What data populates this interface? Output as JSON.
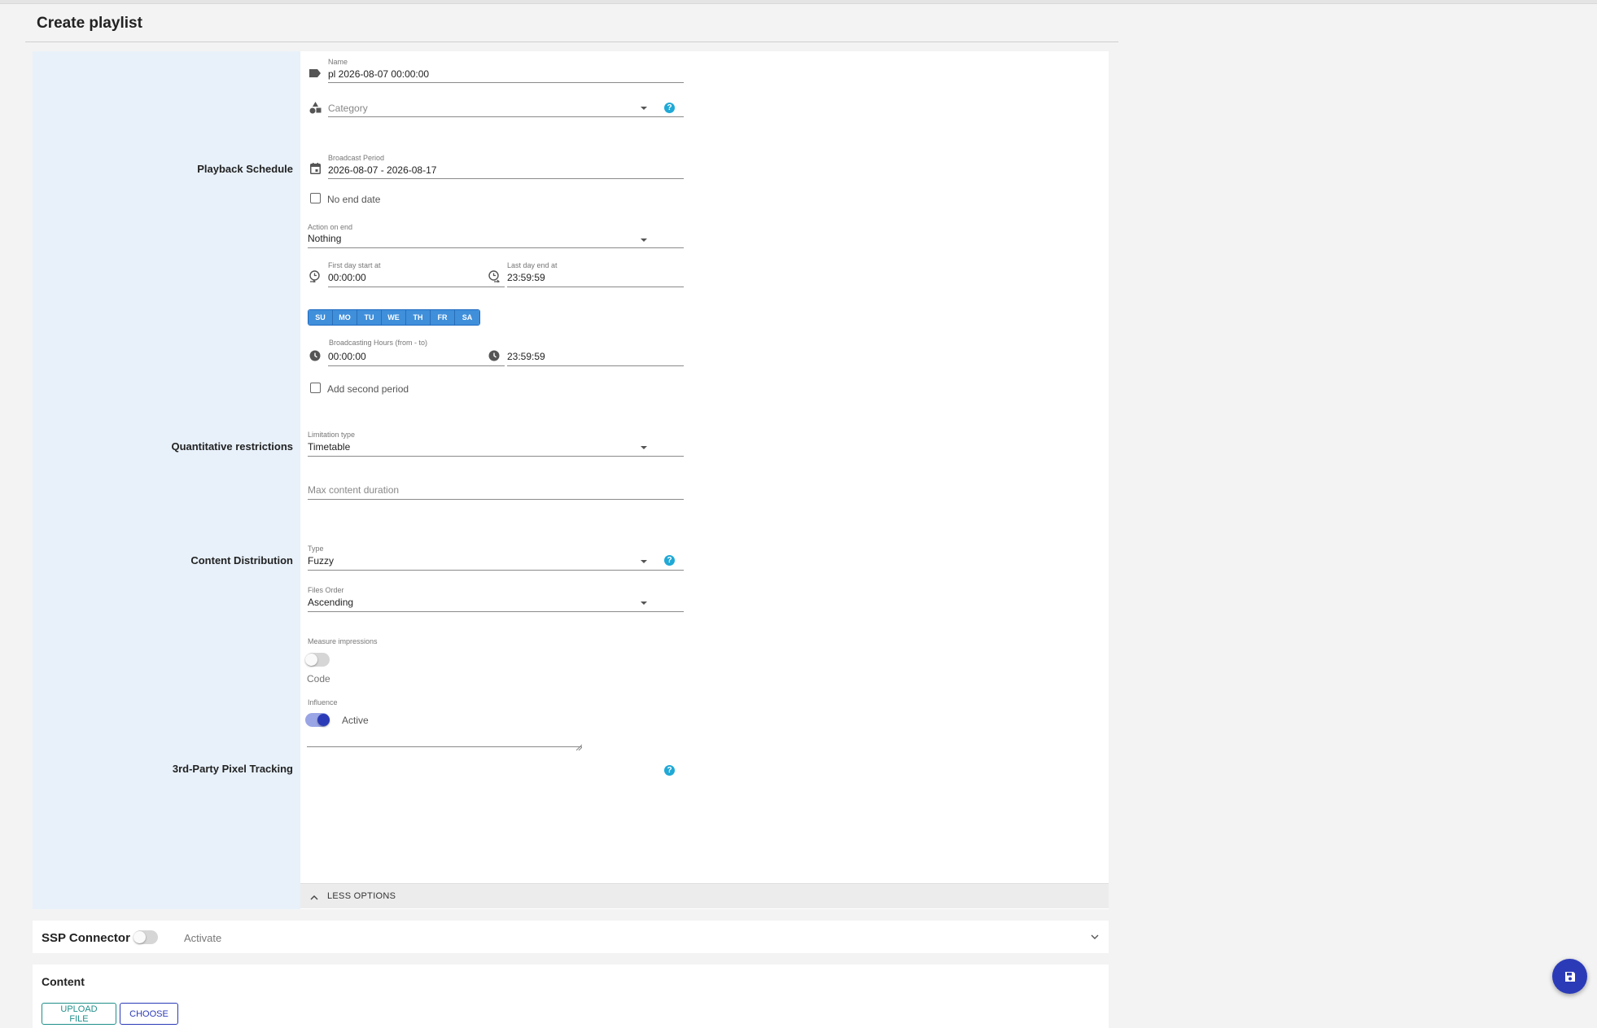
{
  "page": {
    "title": "Create playlist"
  },
  "sections": {
    "playback_schedule": "Playback Schedule",
    "quantitative_restrictions": "Quantitative restrictions",
    "content_distribution": "Content Distribution",
    "pixel_tracking": "3rd-Party Pixel Tracking"
  },
  "form": {
    "name": {
      "label": "Name",
      "value": "pl 2026-08-07 00:00:00",
      "icon": "label-icon"
    },
    "category": {
      "placeholder": "Category",
      "icon": "category-shapes-icon"
    },
    "broadcast_period": {
      "label": "Broadcast Period",
      "value": "2026-08-07 - 2026-08-17",
      "icon": "calendar-icon"
    },
    "no_end_date": {
      "label": "No end date",
      "checked": false
    },
    "action_on_end": {
      "label": "Action on end",
      "value": "Nothing"
    },
    "first_day_start": {
      "label": "First day start at",
      "value": "00:00:00",
      "icon": "alarm-start-icon"
    },
    "last_day_end": {
      "label": "Last day end at",
      "value": "23:59:59",
      "icon": "alarm-end-icon"
    },
    "days": [
      "SU",
      "MO",
      "TU",
      "WE",
      "TH",
      "FR",
      "SA"
    ],
    "broadcasting_hours": {
      "label": "Broadcasting Hours (from - to)",
      "from": "00:00:00",
      "to": "23:59:59",
      "icon": "clock-icon"
    },
    "add_second_period": {
      "label": "Add second period",
      "checked": false
    },
    "limitation_type": {
      "label": "Limitation type",
      "value": "Timetable"
    },
    "max_content_duration": {
      "placeholder": "Max content duration"
    },
    "distribution_type": {
      "label": "Type",
      "value": "Fuzzy"
    },
    "files_order": {
      "label": "Files Order",
      "value": "Ascending"
    },
    "measure_impressions": {
      "label": "Measure impressions",
      "on": false
    },
    "influence": {
      "label": "Influence",
      "state": "Active",
      "on": true
    },
    "code": {
      "placeholder": "Code"
    },
    "help_glyph": "?"
  },
  "less_options": "LESS OPTIONS",
  "ssp": {
    "title": "SSP Connector",
    "activate": "Activate",
    "on": false
  },
  "content": {
    "title": "Content",
    "upload": "UPLOAD FILE",
    "choose": "CHOOSE"
  },
  "save_fab": {
    "icon": "save-icon"
  },
  "colors": {
    "accent": "#2b3bb8",
    "help": "#20a9d6",
    "day_button": "#3f8fdb",
    "side_panel": "#e8f1fa",
    "upload_teal": "#1f8f8a"
  }
}
